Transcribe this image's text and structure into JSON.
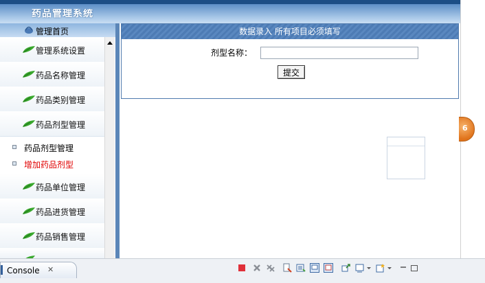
{
  "app": {
    "banner_title": "药品管理系统"
  },
  "sidebar": {
    "home_label": "管理首页",
    "items": [
      {
        "label": "管理系统设置"
      },
      {
        "label": "药品名称管理"
      },
      {
        "label": "药品类别管理"
      },
      {
        "label": "药品剂型管理"
      },
      {
        "label": "药品单位管理"
      },
      {
        "label": "药品进货管理"
      },
      {
        "label": "药品销售管理"
      }
    ],
    "subitems": [
      {
        "label": "药品剂型管理",
        "color": "#000000"
      },
      {
        "label": "增加药品剂型",
        "color": "#e00000"
      }
    ]
  },
  "form": {
    "header": "数据录入  所有项目必须填写",
    "field_label": "剂型名称：",
    "field_value": "",
    "submit_label": "提交"
  },
  "badge": {
    "text": "6"
  },
  "console": {
    "tab_label": "Console",
    "tab_close": "✕"
  },
  "colors": {
    "accent": "#5b86b8",
    "banner": "#1c4e86",
    "stop_red": "#e0303a"
  }
}
